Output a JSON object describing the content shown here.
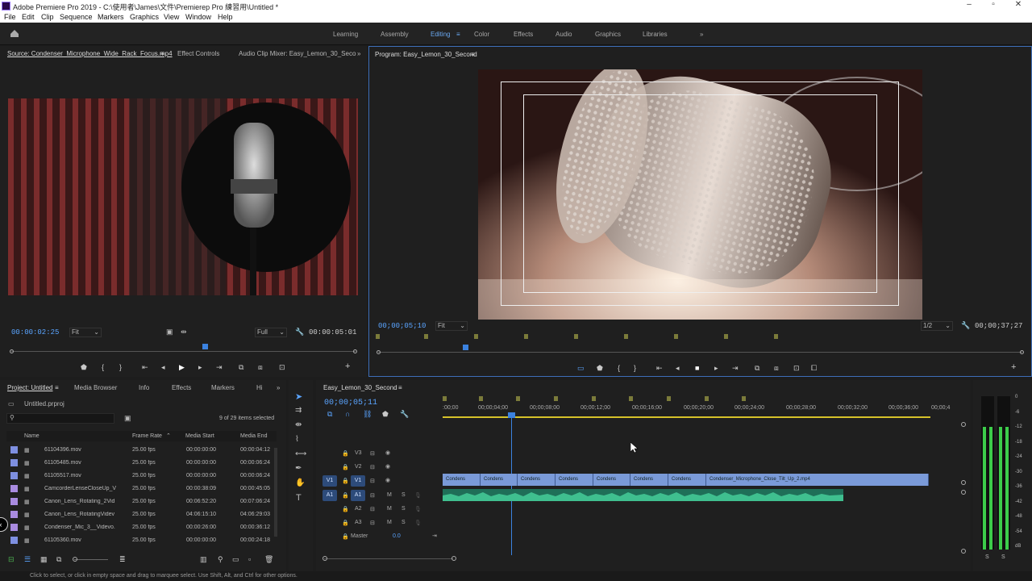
{
  "window": {
    "title": "Adobe Premiere Pro 2019 - C:\\使用者\\James\\文件\\Premierep Pro 練習用\\Untitled *"
  },
  "menu": [
    "File",
    "Edit",
    "Clip",
    "Sequence",
    "Markers",
    "Graphics",
    "View",
    "Window",
    "Help"
  ],
  "workspaces": {
    "tabs": [
      "Learning",
      "Assembly",
      "Editing",
      "Color",
      "Effects",
      "Audio",
      "Graphics",
      "Libraries"
    ],
    "active": "Editing",
    "more": "»"
  },
  "source": {
    "tabs": [
      "Source: Condenser_Microphone_Wide_Rack_Focus.mp4",
      "Effect Controls",
      "Audio Clip Mixer: Easy_Lemon_30_Seco"
    ],
    "timecode": "00:00:02:25",
    "fit": "Fit",
    "quality": "Full",
    "duration": "00:00:05:01"
  },
  "program": {
    "tab": "Program: Easy_Lemon_30_Second",
    "timecode": "00;00;05;10",
    "fit": "Fit",
    "resolution": "1/2",
    "duration": "00;00;37;27"
  },
  "project": {
    "tabs": [
      "Project: Untitled",
      "Media Browser",
      "Info",
      "Effects",
      "Markers",
      "Hi"
    ],
    "file": "Untitled.prproj",
    "count": "9 of 29 items selected",
    "columns": [
      "Name",
      "Frame Rate",
      "Media Start",
      "Media End"
    ],
    "rows": [
      {
        "name": "61104396.mov",
        "rate": "25.00 fps",
        "start": "00:00:00:00",
        "end": "00:00:04:12",
        "type": "clip"
      },
      {
        "name": "61105485.mov",
        "rate": "25.00 fps",
        "start": "00:00:00:00",
        "end": "00:00:06:24",
        "type": "clip"
      },
      {
        "name": "61105517.mov",
        "rate": "25.00 fps",
        "start": "00:00:00:00",
        "end": "00:00:06:24",
        "type": "clip"
      },
      {
        "name": "CamcorderLenseCloseUp_V",
        "rate": "25.00 fps",
        "start": "00:00:38:09",
        "end": "00:00:45:05",
        "type": "mov"
      },
      {
        "name": "Canon_Lens_Rotating_2Vid",
        "rate": "25.00 fps",
        "start": "00:06:52:20",
        "end": "00:07:06:24",
        "type": "mov"
      },
      {
        "name": "Canon_Lens_RotatingVidev",
        "rate": "25.00 fps",
        "start": "04:06:15:10",
        "end": "04:06:29:03",
        "type": "mov"
      },
      {
        "name": "Condenser_Mic_3__Videvo.",
        "rate": "25.00 fps",
        "start": "00:00:26:00",
        "end": "00:00:36:12",
        "type": "mov"
      },
      {
        "name": "61105360.mov",
        "rate": "25.00 fps",
        "start": "00:00:00:00",
        "end": "00:00:24:18",
        "type": "clip"
      }
    ]
  },
  "timeline": {
    "tab": "Easy_Lemon_30_Second",
    "timecode": "00;00;05;11",
    "ruler": [
      ":00;00",
      "00;00;04;00",
      "00;00;08;00",
      "00;00;12;00",
      "00;00;16;00",
      "00;00;20;00",
      "00;00;24;00",
      "00;00;28;00",
      "00;00;32;00",
      "00;00;36;00",
      "00;00;4"
    ],
    "video_tracks": [
      "V3",
      "V2",
      "V1"
    ],
    "audio_tracks": [
      "A1",
      "A2",
      "A3"
    ],
    "master": "Master",
    "master_value": "0.0",
    "source_v": "V1",
    "source_a": "A1",
    "clips": [
      "Condens",
      "Condens",
      "Condens",
      "Condens",
      "Condens",
      "Condens",
      "Condens",
      "Condenser_Microphone_Close_Tilt_Up_2.mp4"
    ],
    "track_m": "M",
    "track_s": "S"
  },
  "meter": {
    "scale": [
      "0",
      "-6",
      "-12",
      "-18",
      "-24",
      "-30",
      "-36",
      "-42",
      "-48",
      "-54",
      "dB"
    ],
    "solo": [
      "S",
      "S"
    ],
    "level": 0.8
  },
  "status": "Click to select, or click in empty space and drag to marquee select. Use Shift, Alt, and Ctrl for other options."
}
